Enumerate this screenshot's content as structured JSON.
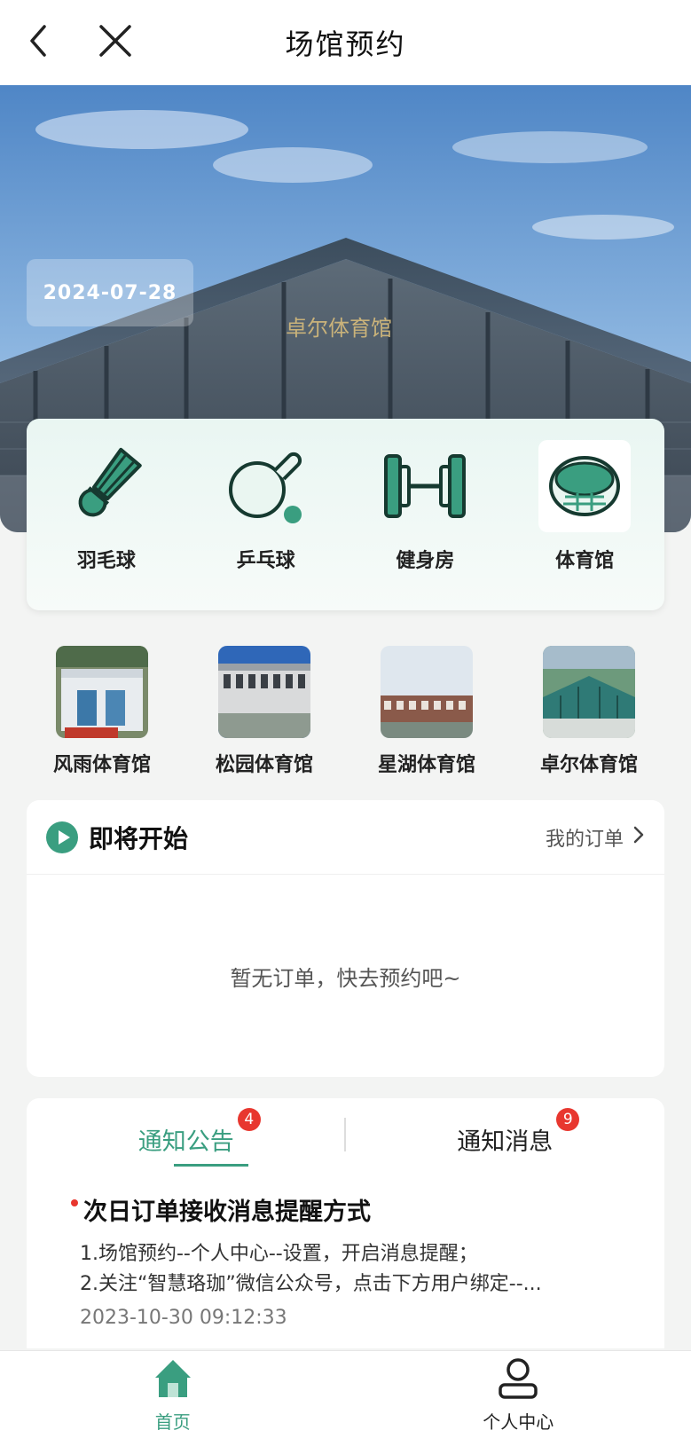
{
  "header": {
    "title": "场馆预约"
  },
  "hero": {
    "date": "2024-07-28",
    "building_sign": "卓尔体育馆"
  },
  "categories": [
    {
      "label": "羽毛球",
      "icon": "badminton-shuttlecock-icon"
    },
    {
      "label": "乒乓球",
      "icon": "ping-pong-paddle-icon"
    },
    {
      "label": "健身房",
      "icon": "dumbbell-icon"
    },
    {
      "label": "体育馆",
      "icon": "stadium-icon"
    }
  ],
  "venues": [
    {
      "name": "风雨体育馆"
    },
    {
      "name": "松园体育馆"
    },
    {
      "name": "星湖体育馆"
    },
    {
      "name": "卓尔体育馆"
    }
  ],
  "upcoming": {
    "title": "即将开始",
    "orders_link": "我的订单",
    "empty_text": "暂无订单，快去预约吧~"
  },
  "notices": {
    "tabs": [
      {
        "label": "通知公告",
        "badge": "4"
      },
      {
        "label": "通知消息",
        "badge": "9"
      }
    ],
    "item": {
      "title": "次日订单接收消息提醒方式",
      "line1": "1.场馆预约--个人中心--设置，开启消息提醒；",
      "line2": "2.关注“智慧珞珈”微信公众号，点击下方用户绑定--...",
      "date": "2023-10-30 09:12:33"
    }
  },
  "bottom_nav": [
    {
      "label": "首页",
      "icon": "home-icon"
    },
    {
      "label": "个人中心",
      "icon": "user-icon"
    }
  ],
  "colors": {
    "accent": "#3a9e80",
    "badge": "#e8372f",
    "background": "#f3f4f3"
  }
}
